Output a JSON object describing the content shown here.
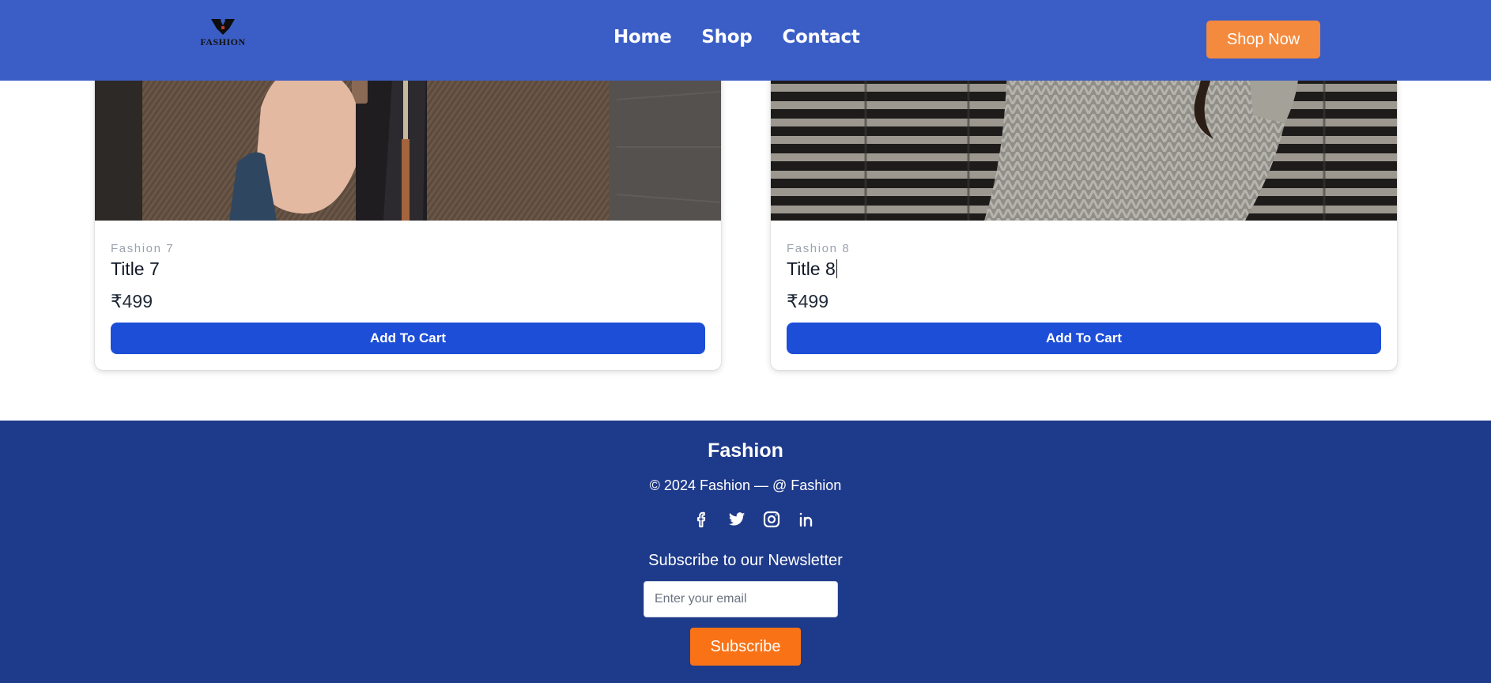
{
  "header": {
    "logo_text": "FASHION",
    "nav": [
      {
        "label": "Home"
      },
      {
        "label": "Shop"
      },
      {
        "label": "Contact"
      }
    ],
    "cta_label": "Shop Now",
    "background": "#3b5ec6",
    "cta_color": "#f48a3d"
  },
  "products": [
    {
      "category": "Fashion 7",
      "title": "Title 7",
      "price": "₹499",
      "button_label": "Add To Cart",
      "image_subject": "man in brown herringbone tweed jacket"
    },
    {
      "category": "Fashion 8",
      "title": "Title 8",
      "price": "₹499",
      "button_label": "Add To Cart",
      "image_subject": "woman in grey knit sweater against striped wall"
    }
  ],
  "footer": {
    "brand": "Fashion",
    "copyright": "© 2024 Fashion —  @ Fashion",
    "socials": [
      {
        "icon": "facebook-icon"
      },
      {
        "icon": "twitter-icon"
      },
      {
        "icon": "instagram-icon"
      },
      {
        "icon": "linkedin-icon"
      }
    ],
    "newsletter_label": "Subscribe to our Newsletter",
    "email_placeholder": "Enter your email",
    "subscribe_label": "Subscribe",
    "background": "#1e3a8a",
    "subscribe_color": "#f97316"
  },
  "colors": {
    "button_blue": "#1d4ed8"
  }
}
